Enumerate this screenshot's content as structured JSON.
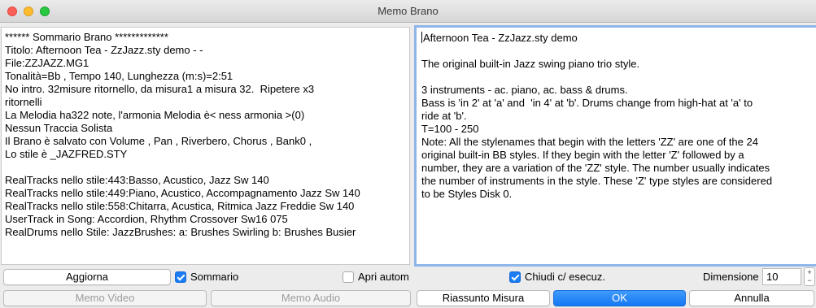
{
  "window": {
    "title": "Memo Brano"
  },
  "summary_lines": [
    "****** Sommario Brano *************",
    "Titolo: Afternoon Tea - ZzJazz.sty demo - -",
    "File:ZZJAZZ.MG1",
    "Tonalità=Bb , Tempo 140, Lunghezza (m:s)=2:51",
    "No intro. 32misure ritornello, da misura1 a misura 32.  Ripetere x3",
    "ritornelli",
    "La Melodia ha322 note, l'armonia Melodia è< ness armonia >(0)",
    "Nessun Traccia Solista",
    "Il Brano è salvato con Volume , Pan , Riverbero, Chorus , Bank0 ,",
    "Lo stile è _JAZFRED.STY",
    "",
    "RealTracks nello stile:443:Basso, Acustico, Jazz Sw 140",
    "RealTracks nello stile:449:Piano, Acustico, Accompagnamento Jazz Sw 140",
    "RealTracks nello stile:558:Chitarra, Acustica, Ritmica Jazz Freddie Sw 140",
    "UserTrack in Song: Accordion, Rhythm Crossover Sw16 075",
    "RealDrums nello Stile: JazzBrushes: a: Brushes Swirling b: Brushes Busier",
    "",
    "",
    "*******************"
  ],
  "memo_lines": [
    "Afternoon Tea - ZzJazz.sty demo",
    "",
    "The original built-in Jazz swing piano trio style.",
    "",
    "3 instruments - ac. piano, ac. bass & drums.",
    "Bass is 'in 2' at 'a' and  'in 4' at 'b'. Drums change from high-hat at 'a' to",
    "ride at 'b'.",
    "T=100 - 250",
    "Note: All the stylenames that begin with the letters 'ZZ' are one of the 24",
    "original built-in BB styles. If they begin with the letter 'Z' followed by a",
    "number, they are a variation of the 'ZZ' style. The number usually indicates",
    "the number of instruments in the style. These 'Z' type styles are considered",
    "to be Styles Disk 0."
  ],
  "controls": {
    "update_button": "Aggiorna",
    "summary_checkbox": {
      "label": "Sommario",
      "checked": true
    },
    "auto_open_checkbox": {
      "label": "Apri autom",
      "checked": false
    },
    "close_on_play_checkbox": {
      "label": "Chiudi c/ esecuz.",
      "checked": true
    },
    "size_label": "Dimensione",
    "size_value": "10",
    "stepper_up": "+",
    "stepper_down": "−"
  },
  "buttons": {
    "video_memo": "Memo Video",
    "audio_memo": "Memo Audio",
    "bar_summary": "Riassunto Misura",
    "ok": "OK",
    "cancel": "Annulla"
  },
  "colors": {
    "accent": "#1a7df5",
    "focus_ring": "#8fb5ea",
    "window_bg": "#ececec"
  }
}
